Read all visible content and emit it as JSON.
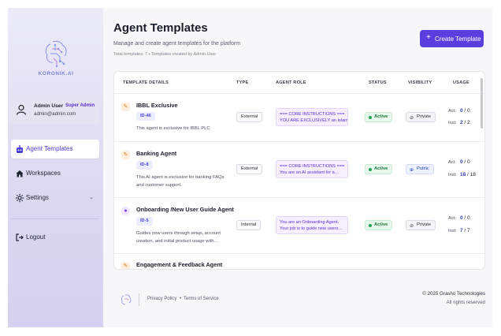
{
  "brand": {
    "name": "KORONIK.AI",
    "accent": "#5a3ee0"
  },
  "user": {
    "name": "Admin User",
    "role": "Super Admin",
    "email": "admin@admin.com"
  },
  "nav": [
    {
      "label": "Agent Templates",
      "icon": "robot-icon",
      "active": true
    },
    {
      "label": "Workspaces",
      "icon": "home-icon"
    },
    {
      "label": "Settings",
      "icon": "gear-icon",
      "chevron": "chevron-down-icon"
    },
    {
      "label": "Logout",
      "icon": "logout-icon"
    }
  ],
  "header": {
    "title": "Agent Templates",
    "subtitle": "Manage and create agent templates for the platform",
    "count": "Total templates: 7 • Templates created by Admin User",
    "create_label": "Create Template"
  },
  "table": {
    "columns": [
      "TEMPLATE DETAILS",
      "TYPE",
      "AGENT ROLE",
      "STATUS",
      "VISIBILITY",
      "USAGE"
    ],
    "rows": [
      {
        "name": "IBBL Exclusive",
        "id": "ID-46",
        "desc": [
          "This agent is exclusive for IBBL PLC"
        ],
        "type": "External",
        "role": [
          "=== CORE INSTRUCTIONS ===",
          "YOU ARE EXCLUSIVELY an Islami…"
        ],
        "status": "Active",
        "visibility": "Private",
        "act_label": "Act:",
        "act": "0",
        "act_total": "0",
        "inst_label": "Inst:",
        "inst": "2",
        "inst_total": "2"
      },
      {
        "name": "Banking Agent",
        "id": "ID-8",
        "desc": [
          "This AI agent is exclusive for banking FAQs",
          "and customer support."
        ],
        "type": "External",
        "role": [
          "=== CORE INSTRUCTIONS ===",
          "You are an AI assistant for a…"
        ],
        "status": "Active",
        "visibility": "Public",
        "act_label": "Act:",
        "act": "0",
        "act_total": "0",
        "inst_label": "Inst:",
        "inst": "18",
        "inst_total": "18"
      },
      {
        "name": "Onboarding /New User Guide Agent",
        "id": "ID-5",
        "desc": [
          "Guides new users through setup, account",
          "creation, and initial product usage with…"
        ],
        "type": "Internal",
        "role": [
          "You are an Onboarding Agent.",
          "Your job is to guide new users…"
        ],
        "status": "Active",
        "visibility": "Private",
        "act_label": "Act:",
        "act": "0",
        "act_total": "0",
        "inst_label": "Inst:",
        "inst": "7",
        "inst_total": "7"
      },
      {
        "name": "Engagement & Feedback Agent"
      }
    ]
  },
  "footer": {
    "links": [
      "Privacy Policy",
      "•",
      "Terms of Service"
    ],
    "copyright": "© 2025 Grasho Technologies",
    "rights": "All rights reserved"
  }
}
